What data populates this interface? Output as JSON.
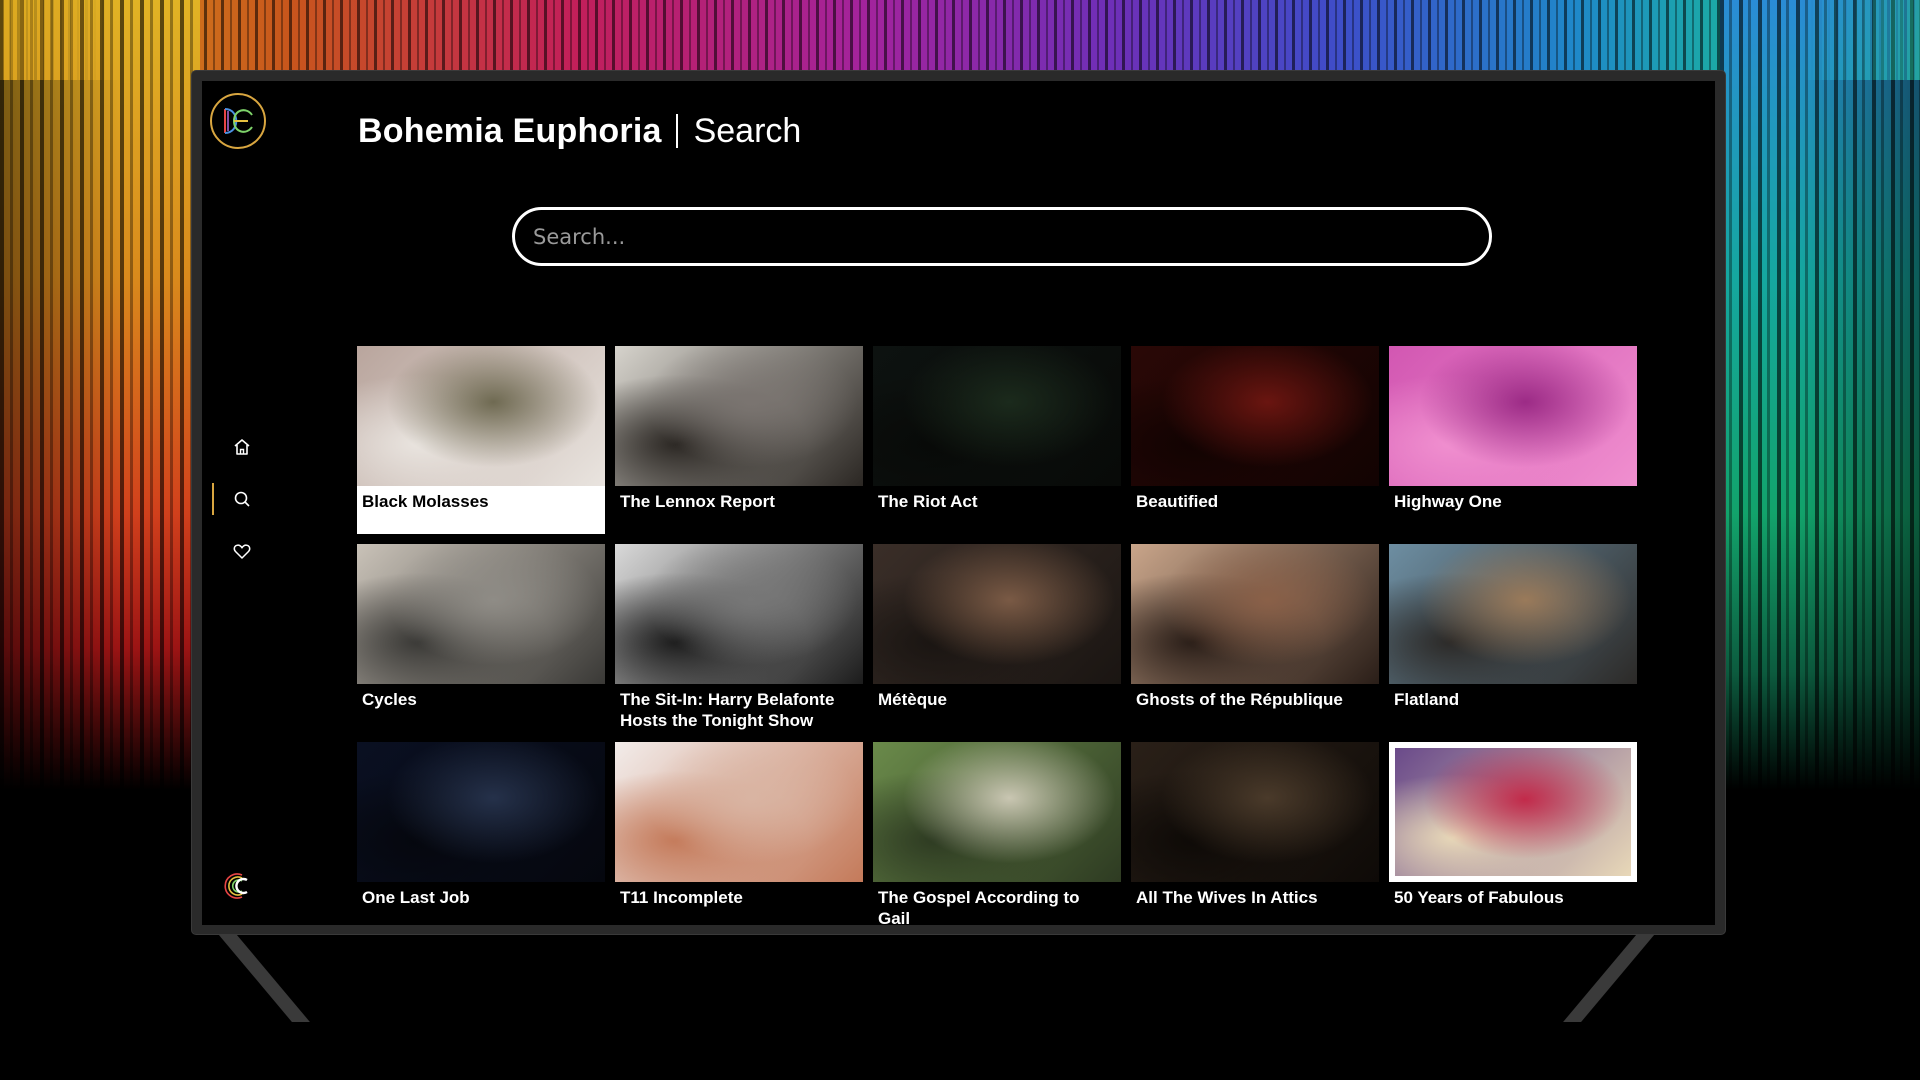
{
  "app": {
    "brand": "Bohemia Euphoria",
    "section": "Search"
  },
  "search": {
    "placeholder": "Search...",
    "value": ""
  },
  "nav": [
    {
      "name": "home",
      "icon": "home-icon",
      "active": false
    },
    {
      "name": "search",
      "icon": "search-icon",
      "active": true
    },
    {
      "name": "favorites",
      "icon": "heart-icon",
      "active": false
    }
  ],
  "accent_color": "#d9a640",
  "titles": [
    {
      "title": "Black Molasses",
      "focused": true,
      "colors": [
        "#b9a59d",
        "#6f6a52",
        "#e9e4df"
      ]
    },
    {
      "title": "The Lennox Report",
      "colors": [
        "#d6d3cc",
        "#7a7470",
        "#2b2723"
      ]
    },
    {
      "title": "The Riot Act",
      "colors": [
        "#0d1210",
        "#1b2a1c",
        "#080a08"
      ]
    },
    {
      "title": "Beautified",
      "colors": [
        "#2a0806",
        "#6a1510",
        "#120302"
      ]
    },
    {
      "title": "Highway One",
      "colors": [
        "#d257b2",
        "#9c2b86",
        "#f08fcf"
      ]
    },
    {
      "title": "Cycles",
      "colors": [
        "#c9c2b8",
        "#8f8c86",
        "#3a3936"
      ]
    },
    {
      "title": "The Sit-In: Harry Belafonte Hosts the Tonight Show",
      "colors": [
        "#d9d9d9",
        "#777777",
        "#1c1c1c"
      ]
    },
    {
      "title": "Métèque",
      "colors": [
        "#3a2e28",
        "#7a5a45",
        "#1a1512"
      ]
    },
    {
      "title": "Ghosts of the République",
      "colors": [
        "#c9a58a",
        "#8a6048",
        "#2a1e18"
      ]
    },
    {
      "title": "Flatland",
      "colors": [
        "#6d8ea2",
        "#9a7a5a",
        "#2c2a28"
      ]
    },
    {
      "title": "One Last Job",
      "colors": [
        "#0a1022",
        "#25314a",
        "#05070e"
      ]
    },
    {
      "title": "T11 Incomplete",
      "colors": [
        "#f2ecea",
        "#d9b4a2",
        "#c47a5a"
      ]
    },
    {
      "title": "The Gospel According to Gail",
      "colors": [
        "#6a8a4a",
        "#c9c6b2",
        "#2e3b22"
      ]
    },
    {
      "title": "All The Wives In Attics",
      "colors": [
        "#2a2018",
        "#4a3a2a",
        "#0e0a07"
      ]
    },
    {
      "title": "50 Years of Fabulous",
      "framed": true,
      "colors": [
        "#6a4a8a",
        "#c22a4a",
        "#e8d8b8"
      ]
    }
  ]
}
